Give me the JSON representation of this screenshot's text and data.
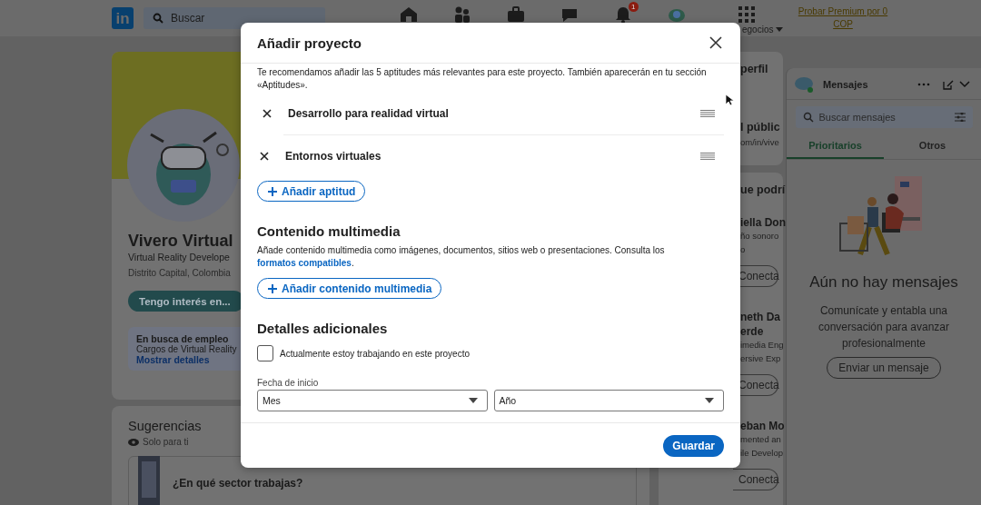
{
  "header": {
    "logo": "in",
    "search": {
      "placeholder": "Buscar"
    },
    "nav": [
      {
        "kind": "home"
      },
      {
        "kind": "people"
      },
      {
        "kind": "briefcase"
      },
      {
        "kind": "chat"
      },
      {
        "kind": "bell",
        "badge": "1"
      },
      {
        "kind": "avatar"
      },
      {
        "kind": "grid",
        "label": "egocios"
      }
    ],
    "premium": "Probar Premium por 0 COP"
  },
  "profile": {
    "name": "Vivero Virtual",
    "headline": "Virtual Reality Develope",
    "location": "Distrito Capital, Colombia",
    "button": "Tengo interés en...",
    "open_to_work": {
      "title": "En busca de empleo",
      "roles": "Cargos de Virtual Reality",
      "link": "Mostrar detalles"
    }
  },
  "suggestions": {
    "title": "Sugerencias",
    "note": "Solo para ti",
    "prompt": "¿En qué sector trabajas?"
  },
  "right_column": [
    {
      "items": [
        {
          "kind": "title",
          "text": "perfil"
        },
        {
          "kind": "title",
          "text": "l públic"
        },
        {
          "kind": "detail",
          "text": "om/in/vive"
        }
      ]
    },
    {
      "items": [
        {
          "kind": "title",
          "text": "ue podrí"
        },
        {
          "kind": "name",
          "text": "iella Don"
        },
        {
          "kind": "detail",
          "text": "ño sonoro"
        },
        {
          "kind": "detail",
          "text": "o"
        },
        {
          "kind": "button",
          "text": "Conecta"
        },
        {
          "kind": "name",
          "text": "neth Da"
        },
        {
          "kind": "name",
          "text": "erde"
        },
        {
          "kind": "detail",
          "text": "imedia Eng"
        },
        {
          "kind": "detail",
          "text": "ersive Exp"
        },
        {
          "kind": "button",
          "text": "Conecta"
        },
        {
          "kind": "name",
          "text": "eban Mo"
        },
        {
          "kind": "detail",
          "text": "mented an"
        },
        {
          "kind": "detail",
          "text": "ile Develop"
        },
        {
          "kind": "button",
          "text": "Conecta"
        }
      ]
    }
  ],
  "messaging": {
    "title": "Mensajes",
    "search": {
      "placeholder": "Buscar mensajes"
    },
    "tabs": [
      {
        "label": "Prioritarios",
        "selected": true
      },
      {
        "label": "Otros",
        "selected": false
      }
    ],
    "empty_title": "Aún no hay mensajes",
    "empty_text": "Comunícate y entabla una conversación para avanzar profesionalmente",
    "button": "Enviar un mensaje"
  },
  "modal": {
    "title": "Añadir proyecto",
    "intro": "Te recomendamos añadir las 5 aptitudes más relevantes para este proyecto. También aparecerán en tu sección «Aptitudes».",
    "skills": [
      {
        "label": "Desarrollo para realidad virtual"
      },
      {
        "label": "Entornos virtuales"
      }
    ],
    "add_skill": "Añadir aptitud",
    "media": {
      "heading": "Contenido multimedia",
      "text": "Añade contenido multimedia como imágenes, documentos, sitios web o presentaciones. Consulta los ",
      "link": "formatos compatibles",
      "after": ".",
      "button": "Añadir contenido multimedia"
    },
    "details": {
      "heading": "Detalles adicionales",
      "current": {
        "label": "Actualmente estoy trabajando en este proyecto",
        "checked": false
      },
      "start_label": "Fecha de inicio",
      "month": "Mes",
      "year": "Año"
    },
    "save": "Guardar"
  }
}
